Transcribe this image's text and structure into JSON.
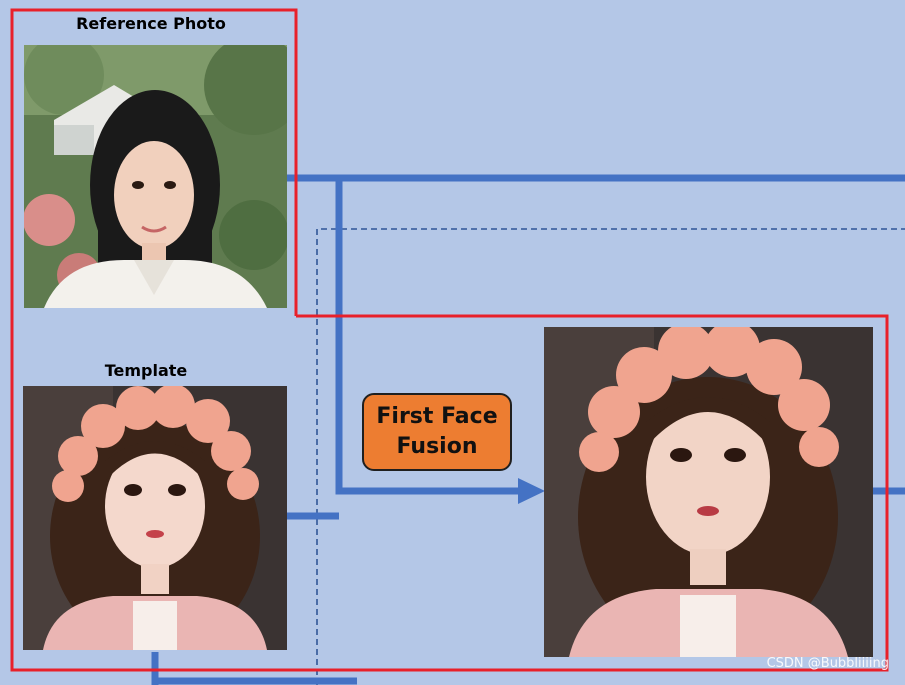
{
  "labels": {
    "reference": "Reference Photo",
    "template": "Template"
  },
  "process": {
    "fusion_line1": "First Face",
    "fusion_line2": "Fusion"
  },
  "watermark": "CSDN @Bubbliiiing",
  "colors": {
    "background": "#b4c7e7",
    "connector": "#4472c4",
    "highlight_border": "#e8202a",
    "process_box": "#ed7d31"
  },
  "icons": [
    "reference-photo-image",
    "template-image",
    "fusion-result-image"
  ]
}
